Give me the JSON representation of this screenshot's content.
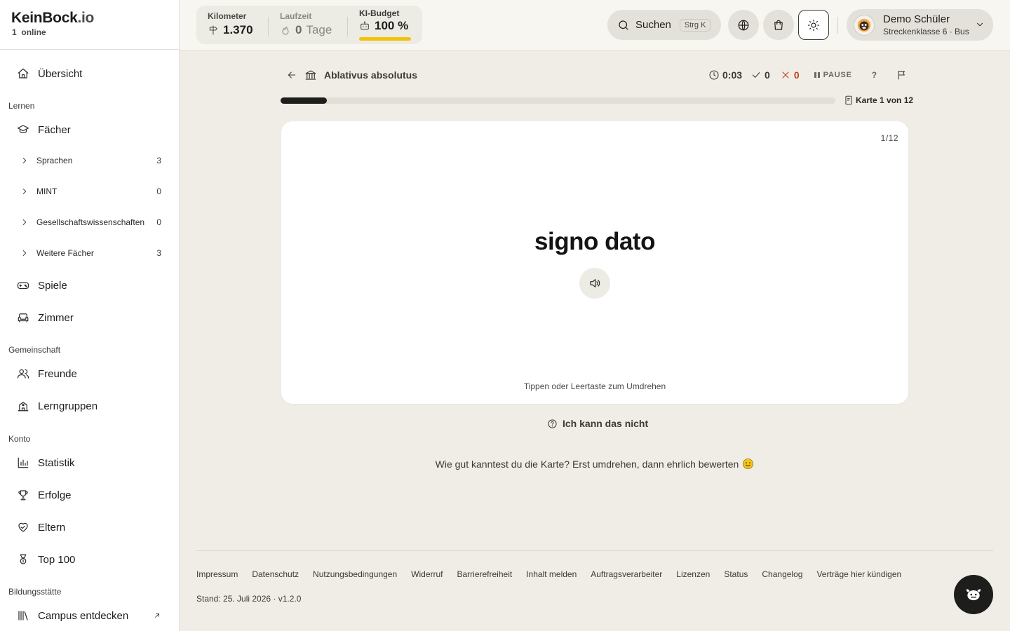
{
  "brand": {
    "name_main": "KeinBock",
    "name_tld": ".io",
    "online_count": "1",
    "online_label": "online"
  },
  "sidebar": {
    "overview": "Übersicht",
    "section_learn": "Lernen",
    "subjects": "Fächer",
    "sub_items": [
      {
        "label": "Sprachen",
        "count": "3"
      },
      {
        "label": "MINT",
        "count": "0"
      },
      {
        "label": "Gesellschaftswissenschaften",
        "count": "0"
      },
      {
        "label": "Weitere Fächer",
        "count": "3"
      }
    ],
    "games": "Spiele",
    "room": "Zimmer",
    "section_community": "Gemeinschaft",
    "friends": "Freunde",
    "study_groups": "Lerngruppen",
    "section_account": "Konto",
    "statistics": "Statistik",
    "achievements": "Erfolge",
    "parents": "Eltern",
    "top100": "Top 100",
    "section_institution": "Bildungsstätte",
    "campus": "Campus entdecken"
  },
  "topbar": {
    "km_label": "Kilometer",
    "km_value": "1.370",
    "runtime_label": "Laufzeit",
    "runtime_value": "0",
    "runtime_unit": "Tage",
    "budget_label": "KI-Budget",
    "budget_value": "100 %",
    "budget_fraction": 1.0,
    "search_label": "Suchen",
    "search_shortcut": "Strg K",
    "user_name": "Demo Schüler",
    "user_sub": "Streckenklasse 6 · Bus"
  },
  "session": {
    "deck_title": "Ablativus absolutus",
    "timer": "0:03",
    "correct": "0",
    "wrong": "0",
    "pause_label": "PAUSE",
    "help_label": "?",
    "progress_fraction": 0.083,
    "card_count_label": "Karte 1 von 12"
  },
  "card": {
    "index": "1/12",
    "term": "signo dato",
    "hint": "Tippen oder Leertaste zum Umdrehen"
  },
  "actions": {
    "cant_label": "Ich kann das nicht",
    "rate_message": "Wie gut kanntest du die Karte? Erst umdrehen, dann ehrlich bewerten"
  },
  "footer": {
    "links": [
      "Impressum",
      "Datenschutz",
      "Nutzungsbedingungen",
      "Widerruf",
      "Barrierefreiheit",
      "Inhalt melden",
      "Auftragsverarbeiter",
      "Lizenzen",
      "Status",
      "Changelog",
      "Verträge hier kündigen"
    ],
    "version": "Stand: 25. Juli 2026 · v1.2.0"
  },
  "colors": {
    "accent_yellow": "#f2c30c",
    "wrong_red": "#c0431e",
    "bg": "#efede6"
  }
}
